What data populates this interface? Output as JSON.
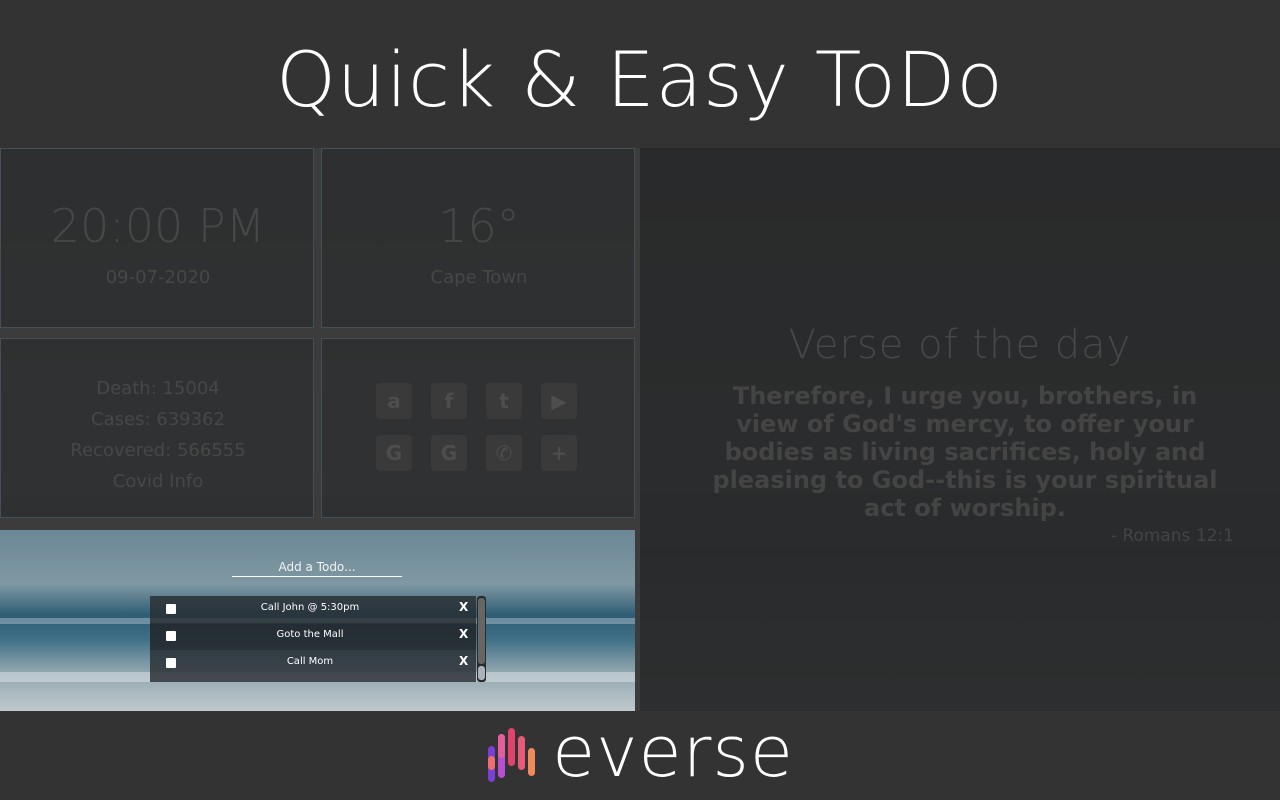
{
  "header": {
    "title": "Quick & Easy ToDo"
  },
  "time_widget": {
    "time": "20:00 PM",
    "date": "09-07-2020"
  },
  "weather_widget": {
    "temp": "16°",
    "city": "Cape Town"
  },
  "covid_widget": {
    "death": "Death: 15004",
    "cases": "Cases: 639362",
    "recovered": "Recovered: 566555",
    "link": "Covid Info"
  },
  "links_widget": {
    "icons": [
      "amazon-icon",
      "facebook-icon",
      "twitter-icon",
      "youtube-icon",
      "google-icon",
      "google-icon",
      "whatsapp-icon",
      "add-icon"
    ],
    "glyphs": [
      "a",
      "f",
      "t",
      "▶",
      "G",
      "G",
      "✆",
      "+"
    ]
  },
  "verse": {
    "title": "Verse of the day",
    "text": "Therefore, I urge you, brothers, in view of God's mercy, to offer your bodies as living sacrifices, holy and pleasing to God--this is your spiritual act of worship.",
    "reference": "- Romans 12:1"
  },
  "todo": {
    "placeholder": "Add a Todo...",
    "items": [
      {
        "text": "Call John @ 5:30pm",
        "delete": "X"
      },
      {
        "text": "Goto the Mall",
        "delete": "X"
      },
      {
        "text": "Call Mom",
        "delete": "X"
      }
    ]
  },
  "footer": {
    "brand": "everse"
  },
  "colors": {
    "background": "#333333",
    "text": "#ffffff",
    "logo_pink": "#e0436b",
    "logo_purple": "#7a3fd6",
    "logo_orange": "#f08a5a"
  }
}
